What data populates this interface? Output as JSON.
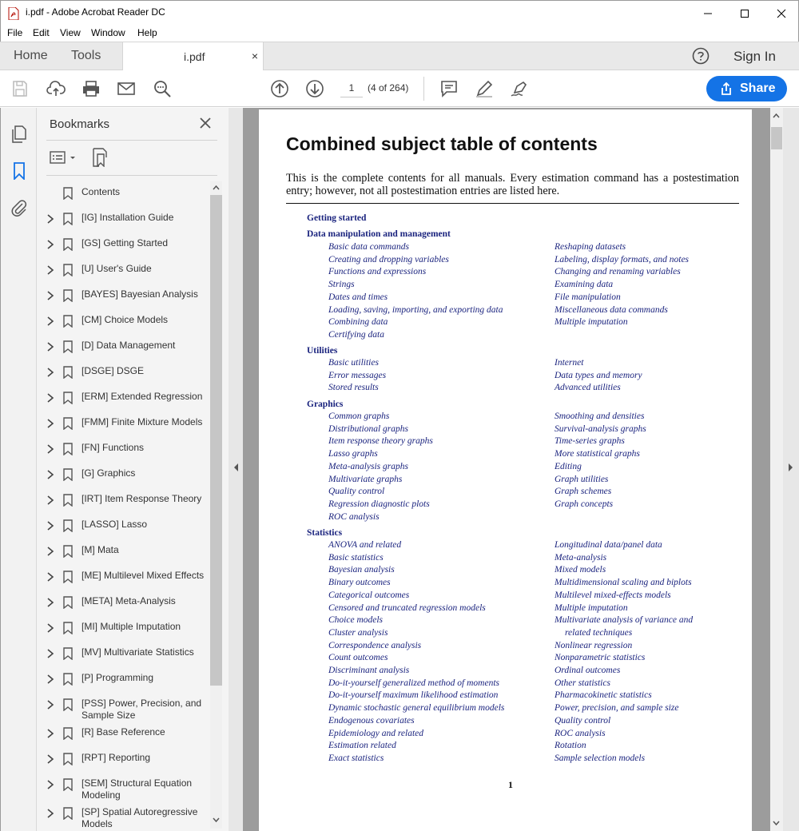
{
  "window": {
    "title": "i.pdf - Adobe Acrobat Reader DC"
  },
  "menu": [
    "File",
    "Edit",
    "View",
    "Window",
    "Help"
  ],
  "tabs": {
    "home": "Home",
    "tools": "Tools",
    "document": "i.pdf",
    "close": "×"
  },
  "account": {
    "sign_in": "Sign In"
  },
  "toolbar": {
    "page_number": "1",
    "page_count": "(4 of 264)",
    "share_label": "Share"
  },
  "bookmarks": {
    "title": "Bookmarks",
    "items": [
      "Contents",
      "[IG] Installation Guide",
      "[GS] Getting Started",
      "[U] User's Guide",
      "[BAYES] Bayesian Analysis",
      "[CM] Choice Models",
      "[D] Data Management",
      "[DSGE] DSGE",
      "[ERM] Extended Regression",
      "[FMM] Finite Mixture Models",
      "[FN] Functions",
      "[G] Graphics",
      "[IRT] Item Response Theory",
      "[LASSO] Lasso",
      "[M] Mata",
      "[ME] Multilevel Mixed Effects",
      "[META] Meta-Analysis",
      "[MI] Multiple Imputation",
      "[MV] Multivariate Statistics",
      "[P] Programming",
      "[PSS] Power, Precision, and Sample Size",
      "[R] Base Reference",
      "[RPT] Reporting",
      "[SEM] Structural Equation Modeling",
      "[SP] Spatial Autoregressive Models"
    ]
  },
  "pdf": {
    "title": "Combined subject table of contents",
    "intro": "This is the complete contents for all manuals. Every estimation command has a postestimation entry; however, not all postestimation entries are listed here.",
    "page_number": "1",
    "headings": [
      "Getting started",
      "Data manipulation and management",
      "Utilities",
      "Graphics",
      "Statistics"
    ],
    "data_left": [
      "Basic data commands",
      "Creating and dropping variables",
      "Functions and expressions",
      "Strings",
      "Dates and times",
      "Loading, saving, importing, and exporting data",
      "Combining data",
      "Certifying data"
    ],
    "data_right": [
      "Reshaping datasets",
      "Labeling, display formats, and notes",
      "Changing and renaming variables",
      "Examining data",
      "File manipulation",
      "Miscellaneous data commands",
      "Multiple imputation"
    ],
    "utilities_left": [
      "Basic utilities",
      "Error messages",
      "Stored results"
    ],
    "utilities_right": [
      "Internet",
      "Data types and memory",
      "Advanced utilities"
    ],
    "graphics_left": [
      "Common graphs",
      "Distributional graphs",
      "Item response theory graphs",
      "Lasso graphs",
      "Meta-analysis graphs",
      "Multivariate graphs",
      "Quality control",
      "Regression diagnostic plots",
      "ROC analysis"
    ],
    "graphics_right": [
      "Smoothing and densities",
      "Survival-analysis graphs",
      "Time-series graphs",
      "More statistical graphs",
      "Editing",
      "Graph utilities",
      "Graph schemes",
      "Graph concepts"
    ],
    "statistics_left": [
      "ANOVA and related",
      "Basic statistics",
      "Bayesian analysis",
      "Binary outcomes",
      "Categorical outcomes",
      "Censored and truncated regression models",
      "Choice models",
      "Cluster analysis",
      "Correspondence analysis",
      "Count outcomes",
      "Discriminant analysis",
      "Do-it-yourself generalized method of moments",
      "Do-it-yourself maximum likelihood estimation",
      "Dynamic stochastic general equilibrium models",
      "Endogenous covariates",
      "Epidemiology and related",
      "Estimation related",
      "Exact statistics"
    ],
    "statistics_right": [
      "Longitudinal data/panel data",
      "Meta-analysis",
      "Mixed models",
      "Multidimensional scaling and biplots",
      "Multilevel mixed-effects models",
      "Multiple imputation",
      "Multivariate analysis of variance and",
      "related techniques",
      "Nonlinear regression",
      "Nonparametric statistics",
      "Ordinal outcomes",
      "Other statistics",
      "Pharmacokinetic statistics",
      "Power, precision, and sample size",
      "Quality control",
      "ROC analysis",
      "Rotation",
      "Sample selection models"
    ]
  },
  "colors": {
    "accent": "#1473e6",
    "link": "#1a237e",
    "canvas": "#9c9c9c"
  }
}
